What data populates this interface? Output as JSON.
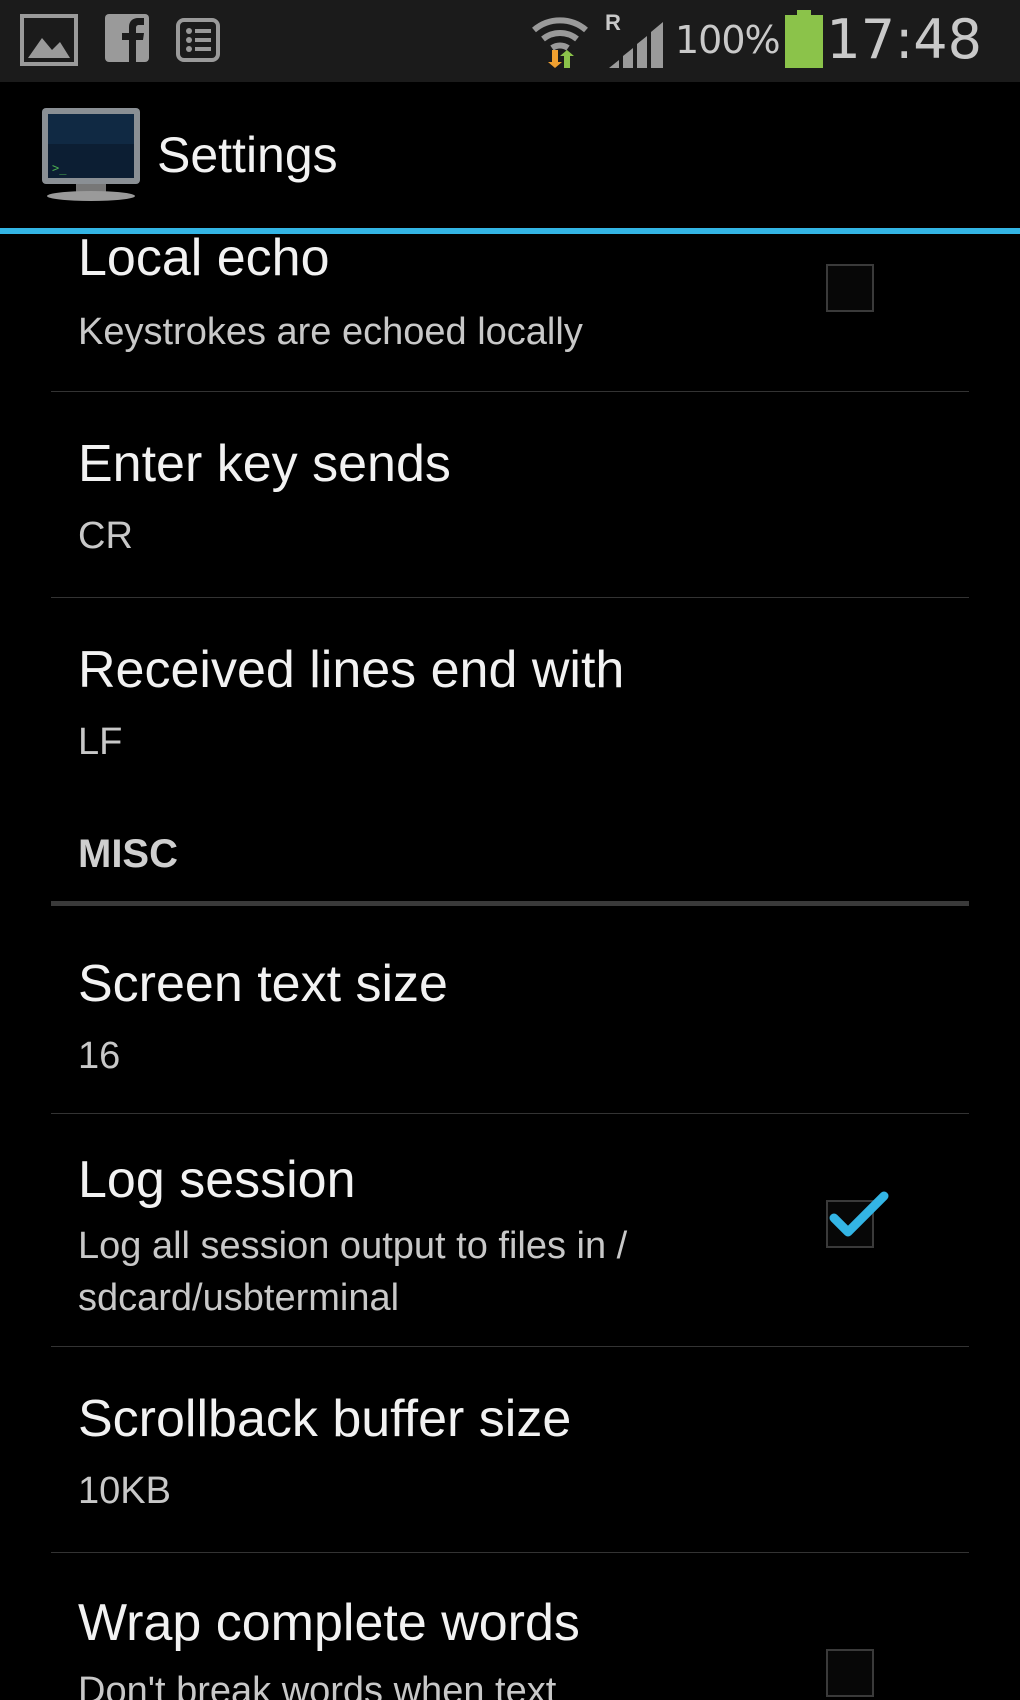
{
  "status_bar": {
    "icons_left": [
      "gallery-icon",
      "facebook-icon",
      "list-icon"
    ],
    "icons_right": [
      "wifi-icon",
      "roaming-signal-icon",
      "battery-icon"
    ],
    "roaming_indicator": "R",
    "battery_percent": "100%",
    "time": "17:48"
  },
  "action_bar": {
    "title": "Settings",
    "accent_color": "#33b5e5"
  },
  "preferences": [
    {
      "title": "Local echo",
      "summary": "Keystrokes are echoed locally",
      "checkbox": true,
      "checked": false
    },
    {
      "title": "Enter key sends",
      "summary": "CR"
    },
    {
      "title": "Received lines end with",
      "summary": "LF"
    },
    {
      "category": "MISC"
    },
    {
      "title": "Screen text size",
      "summary": "16"
    },
    {
      "title": "Log session",
      "summary": "Log all session output to files in / sdcard/usbterminal",
      "checkbox": true,
      "checked": true
    },
    {
      "title": "Scrollback buffer size",
      "summary": "10KB"
    },
    {
      "title": "Wrap complete words",
      "summary": "Don't break words when text",
      "checkbox": true,
      "checked": false
    }
  ]
}
